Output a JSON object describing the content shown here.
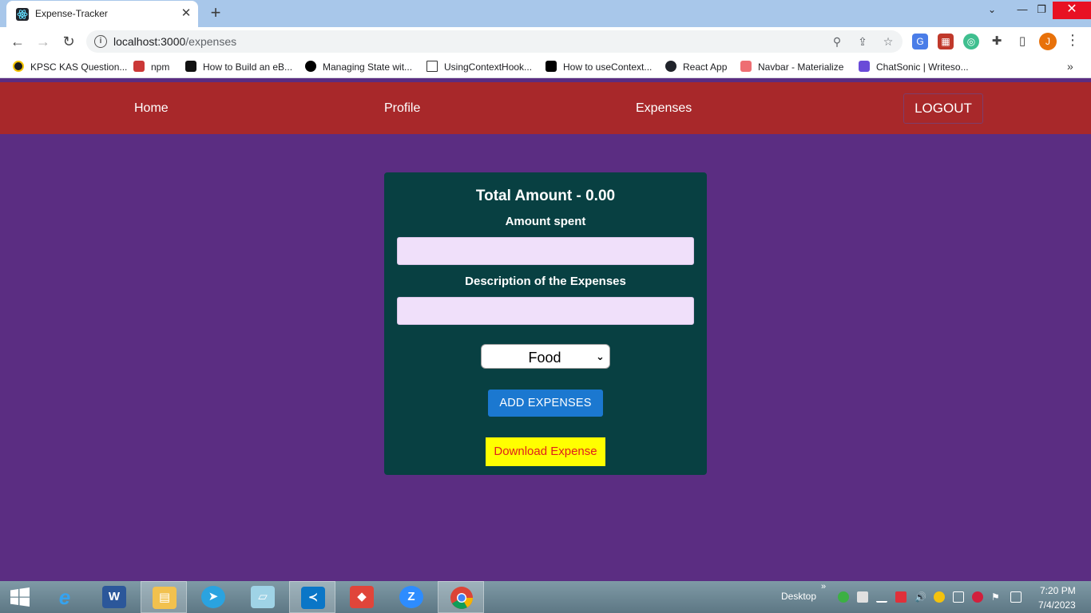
{
  "browser": {
    "tab_title": "Expense-Tracker",
    "tab_close": "✕",
    "new_tab": "+",
    "window_controls": {
      "minimize": "—",
      "restore": "❐",
      "close": "✕"
    },
    "url_host": "localhost:3000",
    "url_path": "/expenses",
    "nav": {
      "back": "←",
      "forward": "→",
      "reload": "↻"
    },
    "profile_initial": "J",
    "bookmarks": [
      "KPSC KAS Question...",
      "npm",
      "How to Build an eB...",
      "Managing State wit...",
      "UsingContextHook...",
      "How to useContext...",
      "React App",
      "Navbar - Materialize",
      "ChatSonic | Writeso..."
    ],
    "bookmarks_more": "»"
  },
  "app": {
    "nav": {
      "home": "Home",
      "profile": "Profile",
      "expenses": "Expenses",
      "logout": "LOGOUT"
    },
    "form": {
      "total_amount": "Total Amount - 0.00",
      "amount_label": "Amount spent",
      "amount_value": "",
      "description_label": "Description of the Expenses",
      "description_value": "",
      "category_selected": "Food",
      "add_button": "ADD EXPENSES",
      "download_button": "Download Expense"
    }
  },
  "taskbar": {
    "desktop_label": "Desktop",
    "overflow": "»",
    "time": "7:20 PM",
    "date": "7/4/2023",
    "apps": [
      "windows-start",
      "internet-explorer",
      "word",
      "file-explorer",
      "telegram",
      "notepad",
      "vscode",
      "git",
      "zoom",
      "chrome"
    ]
  },
  "colors": {
    "page_bg": "#5b2d82",
    "navbar_bg": "#a8282a",
    "card_bg": "#084042",
    "input_bg": "#f0e0fa",
    "add_button_bg": "#1b78d0",
    "download_button_bg": "#ffff00",
    "download_button_text": "#e0201b"
  }
}
